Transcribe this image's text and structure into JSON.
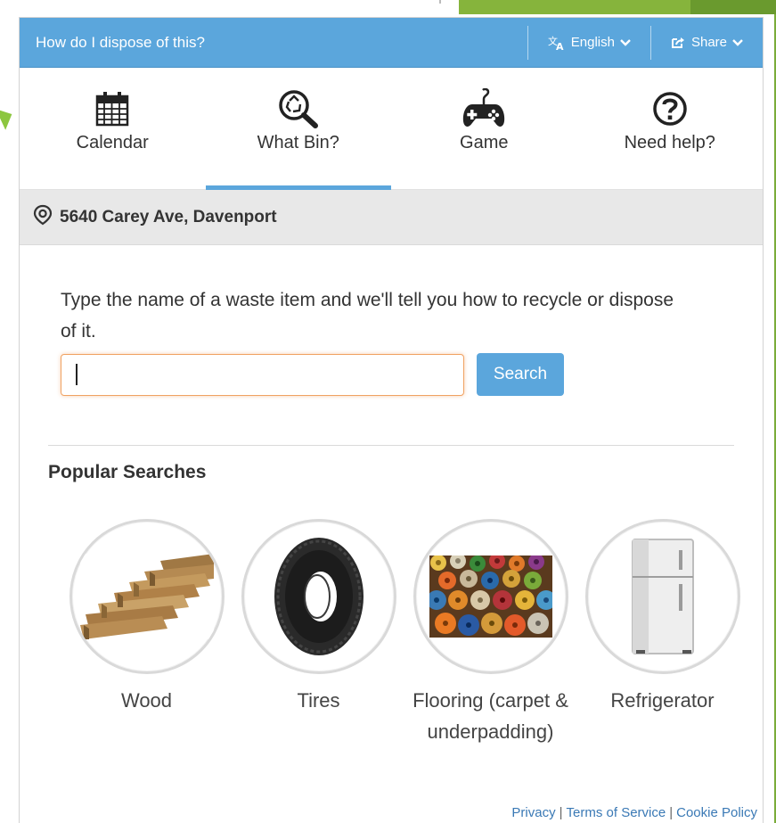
{
  "header": {
    "title": "How do I dispose of this?",
    "language_label": "English",
    "share_label": "Share",
    "color": "#5ba6dc"
  },
  "tabs": [
    {
      "label": "Calendar",
      "icon": "calendar-icon",
      "active": false
    },
    {
      "label": "What Bin?",
      "icon": "recycle-search-icon",
      "active": true
    },
    {
      "label": "Game",
      "icon": "gamepad-icon",
      "active": false
    },
    {
      "label": "Need help?",
      "icon": "question-circle-icon",
      "active": false
    }
  ],
  "location": {
    "address": "5640 Carey Ave, Davenport",
    "icon": "location-pin-icon"
  },
  "search": {
    "intro": "Type the name of a waste item and we'll tell you how to recycle or dispose of it.",
    "value": "",
    "button_label": "Search"
  },
  "popular": {
    "title": "Popular Searches",
    "items": [
      {
        "label": "Wood",
        "icon": "wood-image"
      },
      {
        "label": "Tires",
        "icon": "tire-image"
      },
      {
        "label": "Flooring (carpet & underpadding)",
        "icon": "carpet-image"
      },
      {
        "label": "Refrigerator",
        "icon": "refrigerator-image"
      }
    ]
  },
  "footer": {
    "privacy": "Privacy",
    "terms": "Terms of Service",
    "cookie": "Cookie Policy"
  }
}
